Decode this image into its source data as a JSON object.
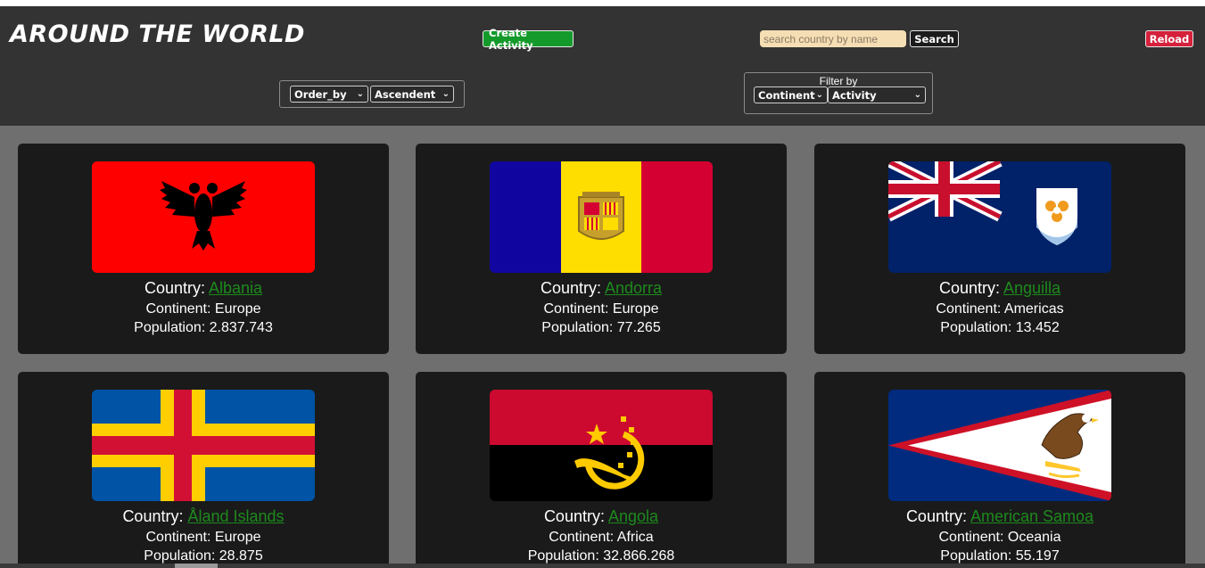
{
  "header": {
    "logo": "AROUND THE WORLD",
    "create_label": "Create Activity",
    "search_placeholder": "search country by name",
    "search_label": "Search",
    "reload_label": "Reload",
    "order": {
      "order_by": "Order_by",
      "direction": "Ascendent"
    },
    "filter": {
      "label": "Filter by",
      "continent": "Continent",
      "activity": "Activity"
    }
  },
  "labels": {
    "country_prefix": "Country: ",
    "continent_prefix": "Continent: ",
    "population_prefix": "Population: "
  },
  "cards": [
    {
      "name": "Albania",
      "continent": "Europe",
      "population": "2.837.743",
      "flag": "albania-flag"
    },
    {
      "name": "Andorra",
      "continent": "Europe",
      "population": "77.265",
      "flag": "andorra-flag"
    },
    {
      "name": "Anguilla",
      "continent": "Americas",
      "population": "13.452",
      "flag": "anguilla-flag"
    },
    {
      "name": "Åland Islands",
      "continent": "Europe",
      "population": "28.875",
      "flag": "aland-flag"
    },
    {
      "name": "Angola",
      "continent": "Africa",
      "population": "32.866.268",
      "flag": "angola-flag"
    },
    {
      "name": "American Samoa",
      "continent": "Oceania",
      "population": "55.197",
      "flag": "american-samoa-flag"
    }
  ],
  "colors": {
    "header_bg": "#333333",
    "page_bg": "#6f6f6f",
    "card_bg": "#1a1a1a",
    "link": "#1d8a1d",
    "create_btn": "#149a2b",
    "reload_btn": "#d5213b",
    "search_bg": "#f5deb3"
  }
}
